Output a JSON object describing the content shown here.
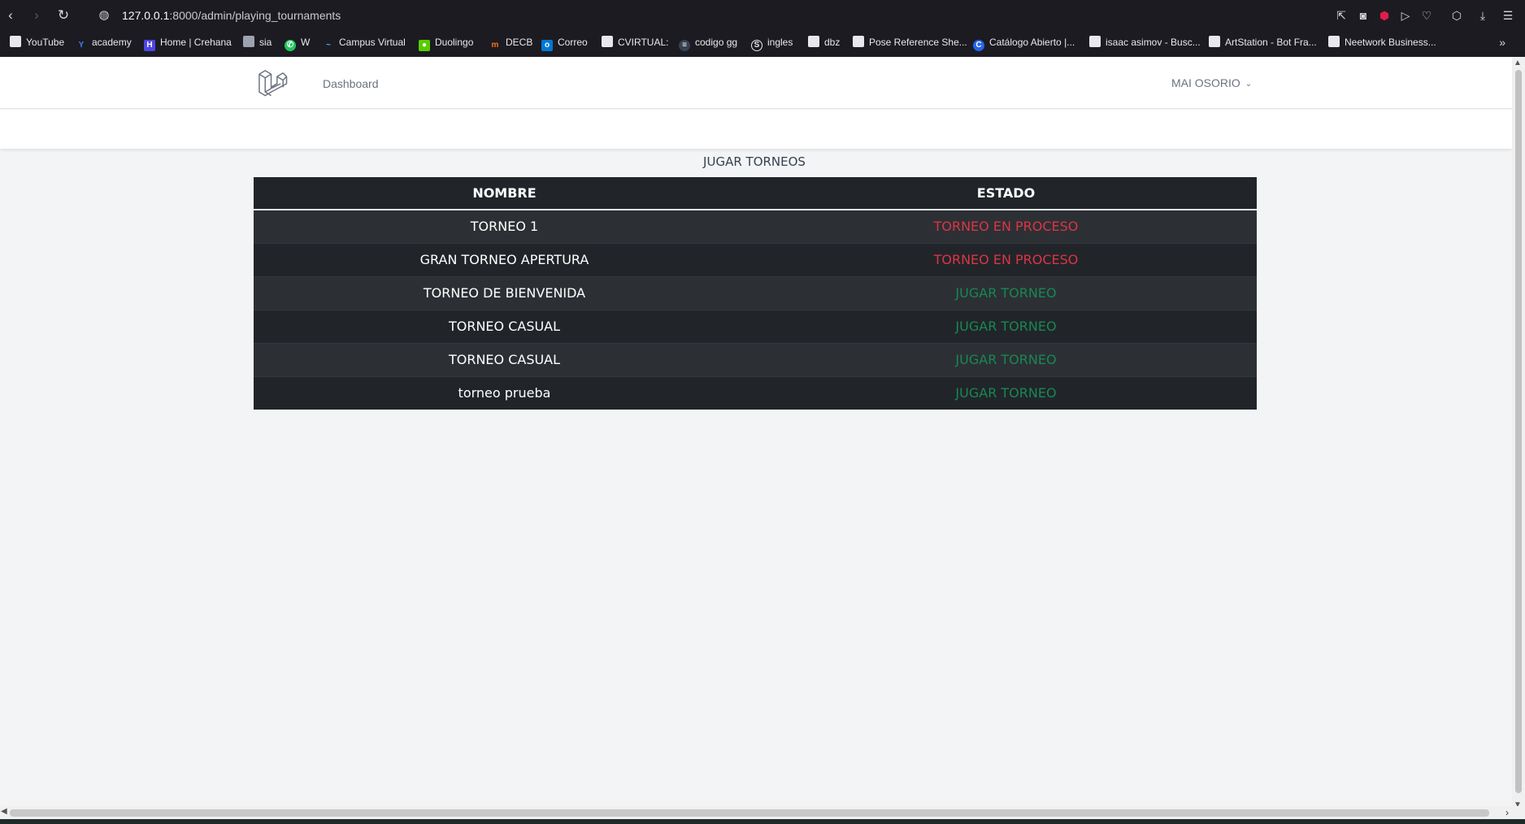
{
  "browser": {
    "url_host": "127.0.0.1",
    "url_path": ":8000/admin/playing_tournaments",
    "bookmarks": [
      {
        "label": "YouTube",
        "icon": "page-icon",
        "color": "#e8e8ec"
      },
      {
        "label": "academy",
        "icon": "y-logo-icon",
        "color": "#3b82f6"
      },
      {
        "label": "Home | Crehana",
        "icon": "crehana-icon",
        "color": "#4f46e5"
      },
      {
        "label": "sia",
        "icon": "sia-icon",
        "color": "#9ca3af"
      },
      {
        "label": "W",
        "icon": "whatsapp-icon",
        "color": "#22c55e"
      },
      {
        "label": "Campus Virtual",
        "icon": "campus-icon",
        "color": "#60a5fa"
      },
      {
        "label": "Duolingo",
        "icon": "duolingo-icon",
        "color": "#58cc02"
      },
      {
        "label": "DECB",
        "icon": "decb-icon",
        "color": "#f97316"
      },
      {
        "label": "Correo",
        "icon": "outlook-icon",
        "color": "#0078d4"
      },
      {
        "label": "CVIRTUAL:",
        "icon": "page-icon",
        "color": "#e8e8ec"
      },
      {
        "label": "codigo gg",
        "icon": "codigo-icon",
        "color": "#374151"
      },
      {
        "label": "ingles",
        "icon": "s-icon",
        "color": "#e8e8ec"
      },
      {
        "label": "dbz",
        "icon": "page-icon",
        "color": "#e8e8ec"
      },
      {
        "label": "Pose Reference She...",
        "icon": "page-icon",
        "color": "#e8e8ec"
      },
      {
        "label": "Catálogo Abierto |...",
        "icon": "c-icon",
        "color": "#2563eb"
      },
      {
        "label": "isaac asimov - Busc...",
        "icon": "page-icon",
        "color": "#e8e8ec"
      },
      {
        "label": "ArtStation - Bot Fra...",
        "icon": "page-icon",
        "color": "#e8e8ec"
      },
      {
        "label": "Neetwork Business...",
        "icon": "page-icon",
        "color": "#e8e8ec"
      }
    ],
    "more": "»"
  },
  "nav": {
    "dashboard": "Dashboard",
    "user": "MAI OSORIO"
  },
  "main": {
    "title": "JUGAR TORNEOS",
    "columns": [
      "NOMBRE",
      "ESTADO"
    ],
    "rows": [
      {
        "name": "TORNEO 1",
        "status": "TORNEO EN PROCESO",
        "status_color": "#dc3545"
      },
      {
        "name": "GRAN TORNEO APERTURA",
        "status": "TORNEO EN PROCESO",
        "status_color": "#dc3545"
      },
      {
        "name": "TORNEO DE BIENVENIDA",
        "status": "JUGAR TORNEO",
        "status_color": "#198754"
      },
      {
        "name": "TORNEO CASUAL",
        "status": "JUGAR TORNEO",
        "status_color": "#198754"
      },
      {
        "name": "TORNEO CASUAL",
        "status": "JUGAR TORNEO",
        "status_color": "#198754"
      },
      {
        "name": "torneo prueba",
        "status": "JUGAR TORNEO",
        "status_color": "#198754"
      }
    ]
  }
}
